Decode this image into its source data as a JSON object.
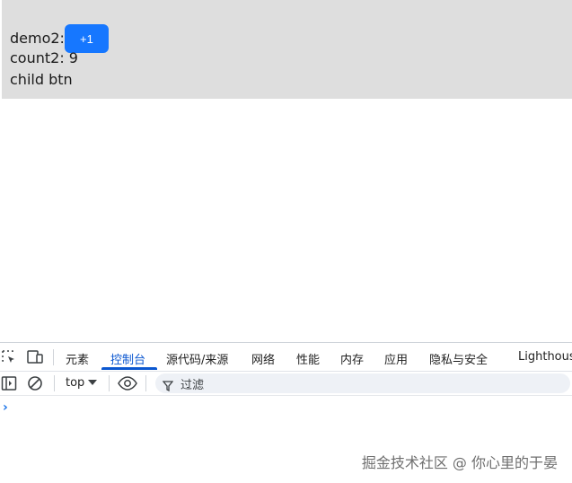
{
  "demo": {
    "label": "demo2:",
    "button_label": "+1",
    "count_text": "count2: 9",
    "child_text": "child btn"
  },
  "devtools": {
    "tabs": [
      "元素",
      "控制台",
      "源代码/来源",
      "网络",
      "性能",
      "内存",
      "应用",
      "隐私与安全",
      "Lighthouse"
    ],
    "active_tab": "控制台",
    "context": "top",
    "filter_placeholder": "过滤",
    "prompt": "›",
    "accent_color": "#0b57d0"
  },
  "watermark": "掘金技术社区 @ 你心里的于晏"
}
